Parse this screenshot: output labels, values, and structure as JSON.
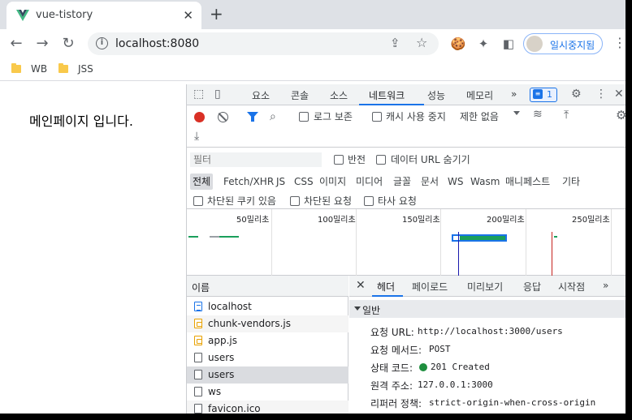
{
  "browser": {
    "tab_title": "vue-tistory",
    "tab_close": "✕",
    "new_tab": "+",
    "url": "localhost:8080",
    "profile_label": "일시중지됨",
    "bookmarks": [
      {
        "label": "WB"
      },
      {
        "label": "JSS"
      }
    ]
  },
  "page": {
    "text": "메인페이지 입니다."
  },
  "devtools": {
    "tabs": [
      "요소",
      "콘솔",
      "소스",
      "네트워크",
      "성능",
      "메모리"
    ],
    "active_tab": "네트워크",
    "more_tabs": "»",
    "issues_count": "1",
    "toolbar": {
      "preserve_log": "로그 보존",
      "disable_cache": "캐시 사용 중지",
      "throttle": "제한 없음"
    },
    "filter": {
      "placeholder": "필터",
      "invert": "반전",
      "hide_data_urls": "데이터 URL 숨기기",
      "types": [
        "전체",
        "Fetch/XHR",
        "JS",
        "CSS",
        "이미지",
        "미디어",
        "글꼴",
        "문서",
        "WS",
        "Wasm",
        "매니페스트",
        "기타"
      ],
      "selected_type": "전체",
      "blocked_cookies": "차단된 쿠키 있음",
      "blocked_requests": "차단된 요청",
      "third_party": "타사 요청"
    },
    "overview": {
      "ticks": [
        "50밀리초",
        "100밀리초",
        "150밀리초",
        "200밀리초",
        "250밀리초"
      ]
    },
    "requests": {
      "header": "이름",
      "rows": [
        {
          "name": "localhost",
          "kind": "doc"
        },
        {
          "name": "chunk-vendors.js",
          "kind": "js"
        },
        {
          "name": "app.js",
          "kind": "js"
        },
        {
          "name": "users",
          "kind": "file"
        },
        {
          "name": "users",
          "kind": "file",
          "selected": true
        },
        {
          "name": "ws",
          "kind": "file"
        },
        {
          "name": "favicon.ico",
          "kind": "file"
        }
      ]
    },
    "detail": {
      "tabs": [
        "헤더",
        "페이로드",
        "미리보기",
        "응답",
        "시작점"
      ],
      "active_tab": "헤더",
      "more": "»",
      "section": "일반",
      "fields": [
        {
          "key": "요청 URL:",
          "value": "http://localhost:3000/users"
        },
        {
          "key": "요청 메서드:",
          "value": "POST"
        },
        {
          "key": "상태 코드:",
          "value": "201 Created"
        },
        {
          "key": "원격 주소:",
          "value": "127.0.0.1:3000"
        },
        {
          "key": "리퍼러 정책:",
          "value": "strict-origin-when-cross-origin"
        }
      ],
      "status_color": "#1e8e3e"
    }
  },
  "colors": {
    "accent": "#1a73e8",
    "record": "#d93025",
    "vue_green": "#41b883"
  }
}
